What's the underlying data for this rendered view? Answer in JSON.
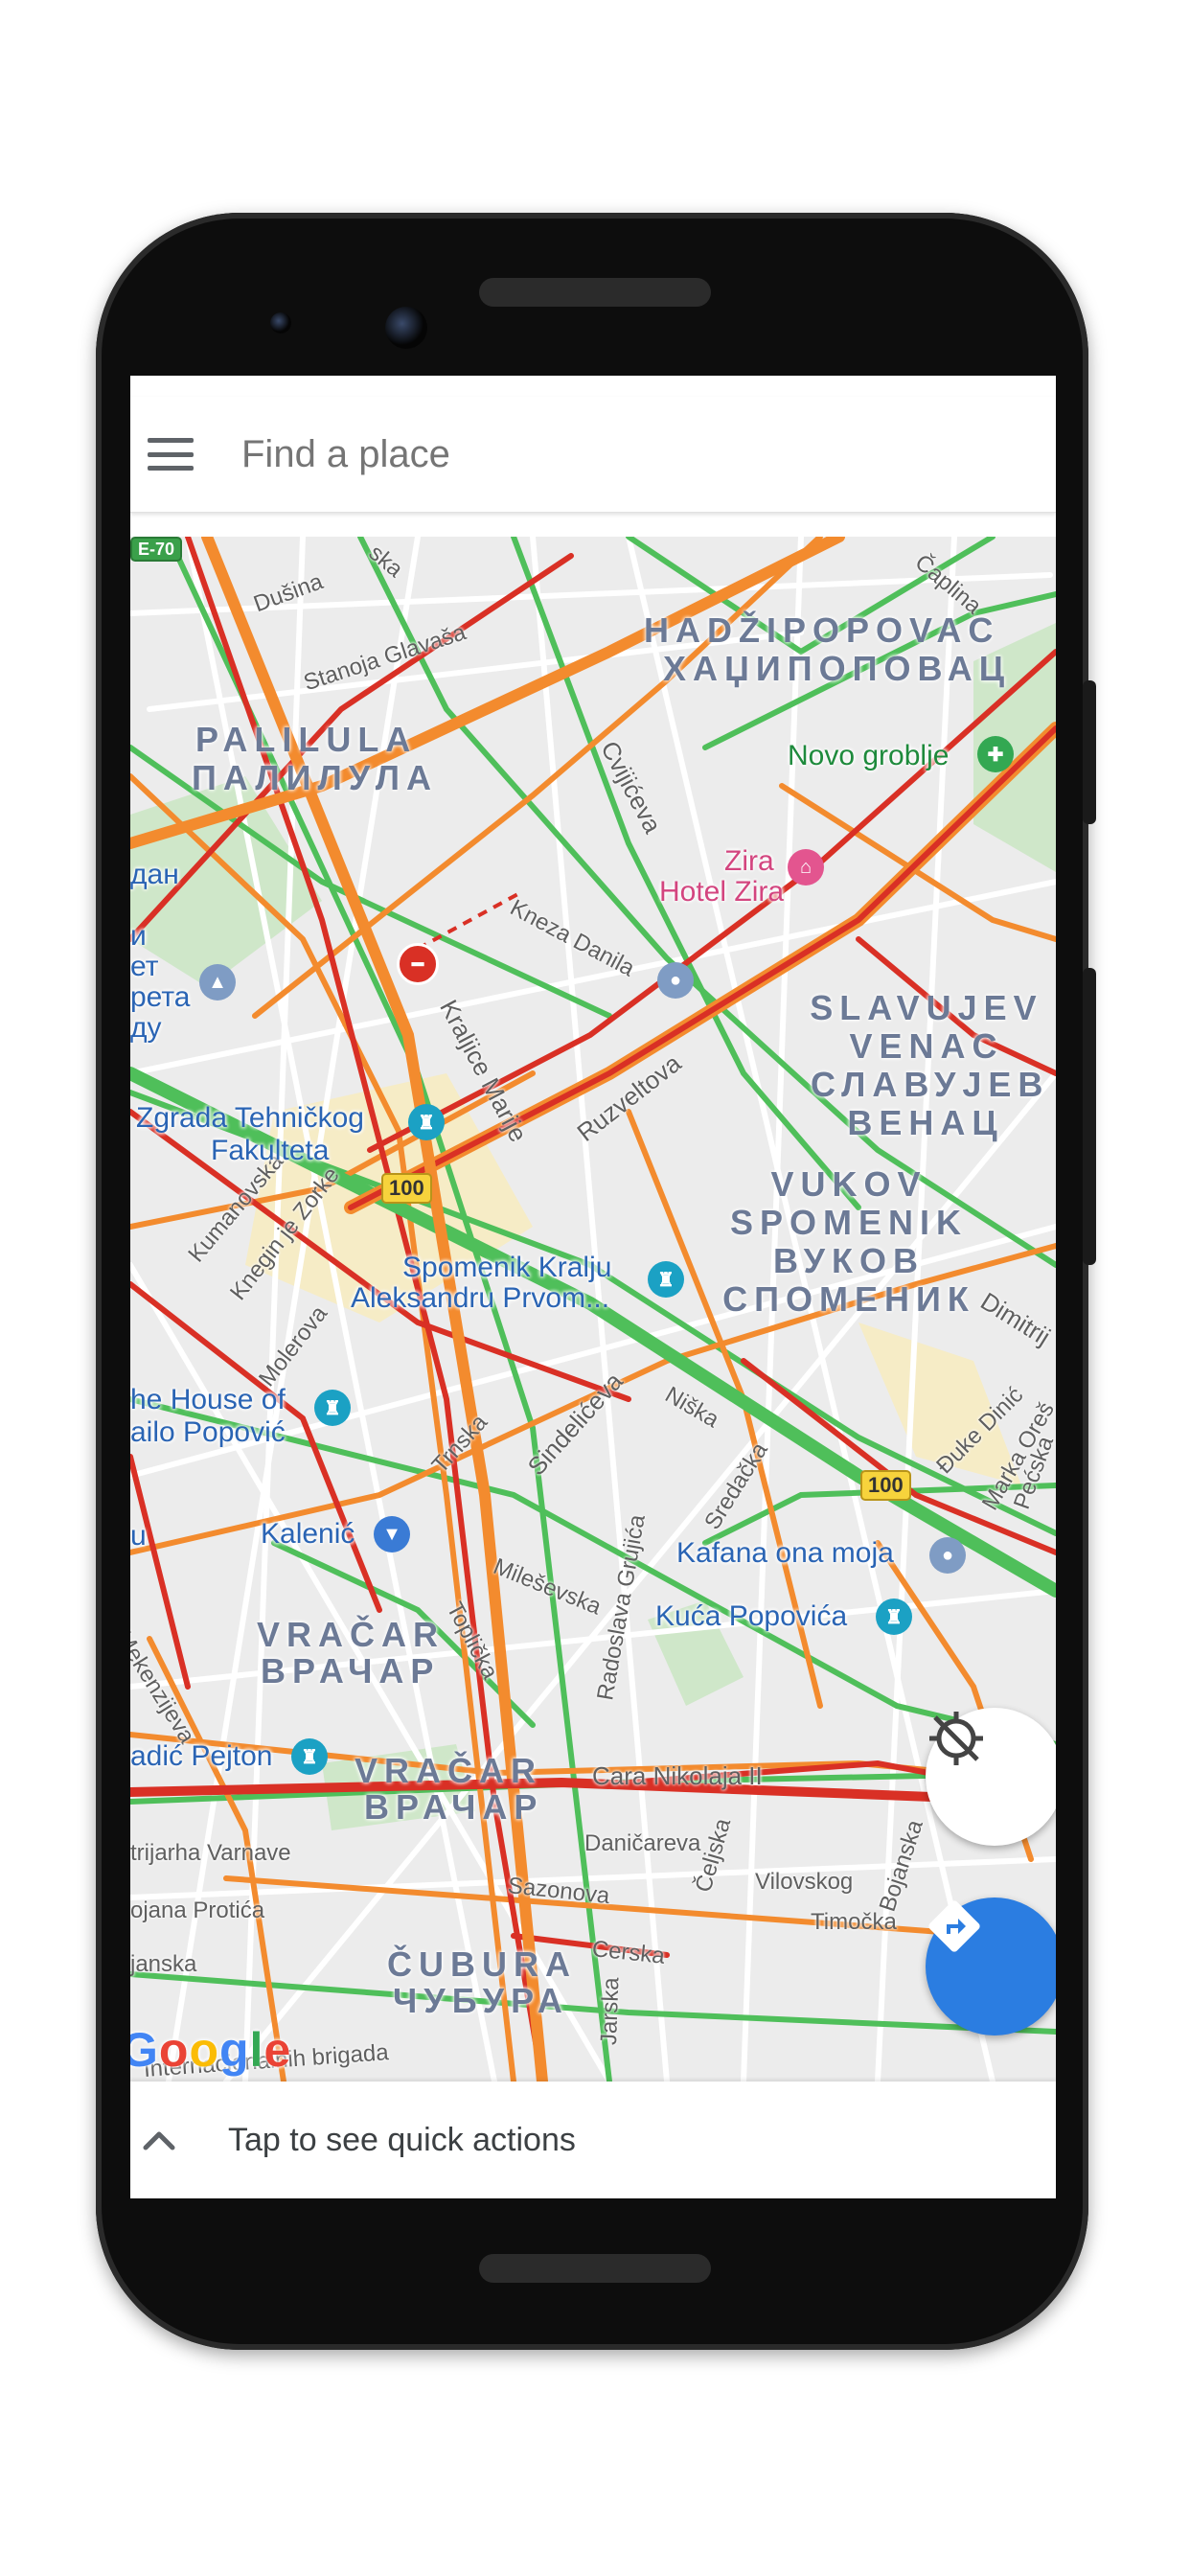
{
  "search": {
    "placeholder": "Find a place"
  },
  "map": {
    "districts": [
      {
        "latin": "PALILULA",
        "cyrillic": "ПАЛИЛУЛА"
      },
      {
        "latin": "HADŽIPOPOVAC",
        "cyrillic": "ХАЏИПОПОВАЦ"
      },
      {
        "latin": "SLAVUJEV VENAC",
        "cyrillic": "СЛАВУЈЕВ ВЕНАЦ"
      },
      {
        "latin": "VUKOV SPOMENIK",
        "cyrillic": "ВУКОВ СПОМЕНИК"
      },
      {
        "latin": "VRAČAR",
        "cyrillic": "ВРАЧАР"
      },
      {
        "latin": "VRAČAR",
        "cyrillic": "ВРАЧАР"
      },
      {
        "latin": "ČUBURA",
        "cyrillic": "ЧУБУРА"
      }
    ],
    "pois": [
      {
        "name": "Novo groblje",
        "icon": "cemetery-icon"
      },
      {
        "name": "Zira",
        "icon": "hotel-icon"
      },
      {
        "name": "Hotel Zira",
        "icon": "hotel-icon"
      },
      {
        "name": "Zgrada Tehničkog",
        "icon": "landmark-icon"
      },
      {
        "name": "Fakulteta",
        "icon": "landmark-icon"
      },
      {
        "name": "Spomenik Kralju",
        "icon": "landmark-icon"
      },
      {
        "name": "Aleksandru Prvom...",
        "icon": "landmark-icon"
      },
      {
        "name": "he House of",
        "icon": "landmark-icon"
      },
      {
        "name": "ailo Popović",
        "icon": "landmark-icon"
      },
      {
        "name": "Kalenić",
        "icon": "shopping-icon"
      },
      {
        "name": "Kafana ona moja",
        "icon": "place-icon"
      },
      {
        "name": "Kuća Popovića",
        "icon": "landmark-icon"
      },
      {
        "name": "adić Pejton",
        "icon": "landmark-icon"
      },
      {
        "name": "дан"
      },
      {
        "name": "и"
      },
      {
        "name": "ет"
      },
      {
        "name": "рета"
      },
      {
        "name": "ду"
      },
      {
        "name": "u"
      }
    ],
    "streets": [
      "Dušina",
      "Stanoja Glavaša",
      "Cvijićeva",
      "Kneza Danila",
      "Kraljice Marije",
      "Ruzveltova",
      "Kumanovska",
      "Knegin je Zorke",
      "Molerova",
      "Trnska",
      "Sindelićeva",
      "Niška",
      "Sredačka",
      "Dimitrij",
      "Đuke Dinić",
      "Marka Oreš",
      "Pećska",
      "Mileševska",
      "Toplička",
      "Radoslava Grujića",
      "Cara Nikolaja II",
      "Daničareva",
      "Čeljska",
      "Vilovskog",
      "Timočka",
      "Bojanska",
      "Sazonova",
      "Cerska",
      "Jarska",
      "Internacionalnih brigada",
      "Mekenzijeva",
      "trijarha Varnave",
      "ojana Protića",
      "janska",
      "E-70",
      "Čaplina",
      "ska"
    ],
    "highway_shields": [
      "100",
      "100"
    ],
    "attribution": "Google"
  },
  "buttons": {
    "locate": "crosshair-off-icon",
    "directions": "directions-icon"
  },
  "bottom_sheet": {
    "text": "Tap to see quick actions"
  },
  "colors": {
    "traffic_green": "#4fbf5a",
    "traffic_orange": "#f38b2e",
    "traffic_red": "#d93025",
    "directions_blue": "#2b7de1"
  }
}
